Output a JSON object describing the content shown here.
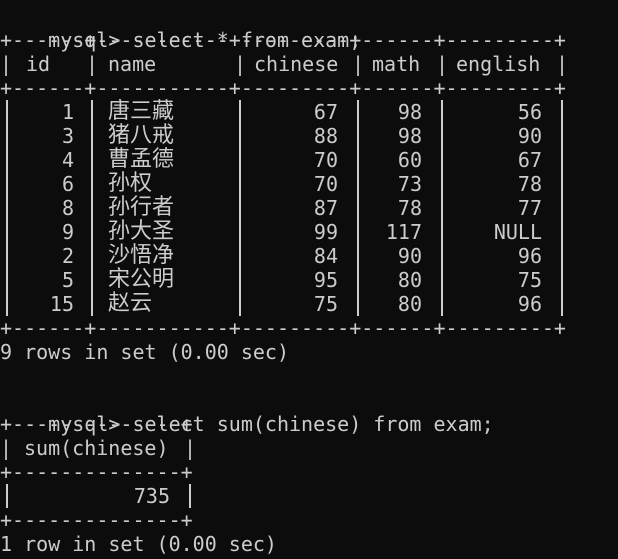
{
  "query1": {
    "prompt": "mysql>",
    "command": "select * from exam;",
    "columns": [
      "id",
      "name",
      "chinese",
      "math",
      "english"
    ],
    "rows": [
      [
        "1",
        "唐三藏",
        "67",
        "98",
        "56"
      ],
      [
        "3",
        "猪八戒",
        "88",
        "98",
        "90"
      ],
      [
        "4",
        "曹孟德",
        "70",
        "60",
        "67"
      ],
      [
        "6",
        "孙权",
        "70",
        "73",
        "78"
      ],
      [
        "8",
        "孙行者",
        "87",
        "78",
        "77"
      ],
      [
        "9",
        "孙大圣",
        "99",
        "117",
        "NULL"
      ],
      [
        "2",
        "沙悟净",
        "84",
        "90",
        "96"
      ],
      [
        "5",
        "宋公明",
        "95",
        "80",
        "75"
      ],
      [
        "15",
        "赵云",
        "75",
        "80",
        "96"
      ]
    ],
    "result": "9 rows in set (0.00 sec)"
  },
  "query2": {
    "prompt": "mysql>",
    "command": "select sum(chinese) from exam;",
    "columns": [
      "sum(chinese)"
    ],
    "rows": [
      [
        "735"
      ]
    ],
    "result": "1 row in set (0.00 sec)"
  },
  "colors": {
    "background": "#0c0c0c",
    "text": "#cccccc"
  }
}
